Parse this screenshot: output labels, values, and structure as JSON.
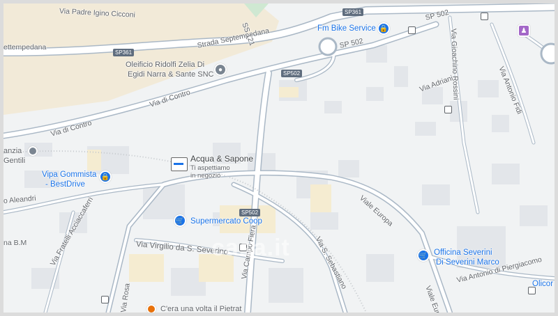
{
  "roads": {
    "via_padre": "Via Padre Igino Cicconi",
    "settempedana_left": "ettempedana",
    "strada_settempedana": "Strada Septempedana",
    "sp121": "SS 121",
    "via_di_contro_mid": "Via di Contro",
    "via_di_contro_left": "Via di Contro",
    "sp502_a": "SP 502",
    "sp502_b": "SP 502",
    "via_adriani": "Via Adriani",
    "via_rossini": "Via Gioachino Rossini",
    "via_fidi": "Via Antonio Fidi",
    "alea": "o Aleandri",
    "via_fratelli": "Via Fratelli Acciaccaferri",
    "via_virgilio": "Via Virgilio da S. Severino",
    "via_campo": "Via Campo Fiera",
    "via_sebastiano": "Via S. Sebastiano",
    "viale_europa_a": "Viale Europa",
    "viale_europa_b": "Viale Europa",
    "via_piergiacomo": "Via Antonio di Piergiacomo",
    "via_rosa": "Via Rosa",
    "b_m": "na B.M"
  },
  "shields": {
    "sp361_top": "SP361",
    "sp361_left": "SP361",
    "sp502_mid": "SP502",
    "sp502_low": "SP502"
  },
  "pois": {
    "fm_bike": "Fm Bike Service",
    "oleificio_1": "Oleificio Ridolfi Zelia Di",
    "oleificio_2": "Egidi Narra & Sante SNC",
    "acqua_title": "Acqua & Sapone",
    "acqua_sub1": "Ti aspettiamo",
    "acqua_sub2": "in negozio",
    "vipa_1": "Vipa Gommista",
    "vipa_2": "- BestDrive",
    "coop": "Supermercato Coop",
    "officina_1": "Officina Severini",
    "officina_2": "Di Severini Marco",
    "olicor": "Olicor",
    "anzia_1": "anzia",
    "anzia_2": "Gentili",
    "cera": "C'era una volta il Pietrat"
  },
  "watermark": "casa.it",
  "colors": {
    "background": "#f1f3f4",
    "road": "#aab8c6",
    "road_fill": "#ffffff",
    "building": "#e3e6ea",
    "park": "#f2ead8",
    "green": "#cfe8d2",
    "poi_blue": "#1a73e8"
  }
}
